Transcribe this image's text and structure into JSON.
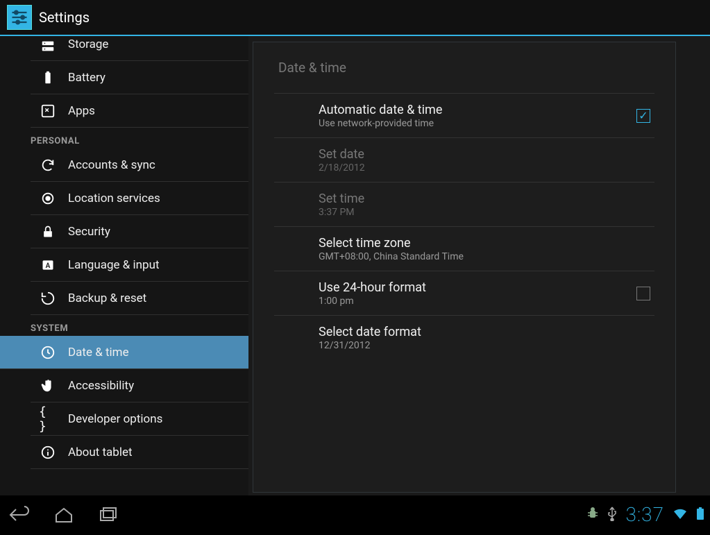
{
  "header": {
    "title": "Settings"
  },
  "sidebar": {
    "items_top": [
      {
        "label": "Storage",
        "icon": "storage-icon"
      },
      {
        "label": "Battery",
        "icon": "battery-icon"
      },
      {
        "label": "Apps",
        "icon": "apps-icon"
      }
    ],
    "section_personal": "PERSONAL",
    "items_personal": [
      {
        "label": "Accounts & sync",
        "icon": "sync-icon"
      },
      {
        "label": "Location services",
        "icon": "location-icon"
      },
      {
        "label": "Security",
        "icon": "lock-icon"
      },
      {
        "label": "Language & input",
        "icon": "language-icon"
      },
      {
        "label": "Backup & reset",
        "icon": "backup-icon"
      }
    ],
    "section_system": "SYSTEM",
    "items_system": [
      {
        "label": "Date & time",
        "icon": "clock-icon",
        "selected": true
      },
      {
        "label": "Accessibility",
        "icon": "hand-icon"
      },
      {
        "label": "Developer options",
        "icon": "braces-icon"
      },
      {
        "label": "About tablet",
        "icon": "info-icon"
      }
    ]
  },
  "content": {
    "title": "Date & time",
    "rows": [
      {
        "title": "Automatic date & time",
        "sub": "Use network-provided time",
        "checkbox": true,
        "checked": true
      },
      {
        "title": "Set date",
        "sub": "2/18/2012",
        "disabled": true
      },
      {
        "title": "Set time",
        "sub": "3:37 PM",
        "disabled": true
      },
      {
        "title": "Select time zone",
        "sub": "GMT+08:00, China Standard Time"
      },
      {
        "title": "Use 24-hour format",
        "sub": "1:00 pm",
        "checkbox": true,
        "checked": false
      },
      {
        "title": "Select date format",
        "sub": "12/31/2012"
      }
    ]
  },
  "navbar": {
    "clock": "3:37"
  }
}
